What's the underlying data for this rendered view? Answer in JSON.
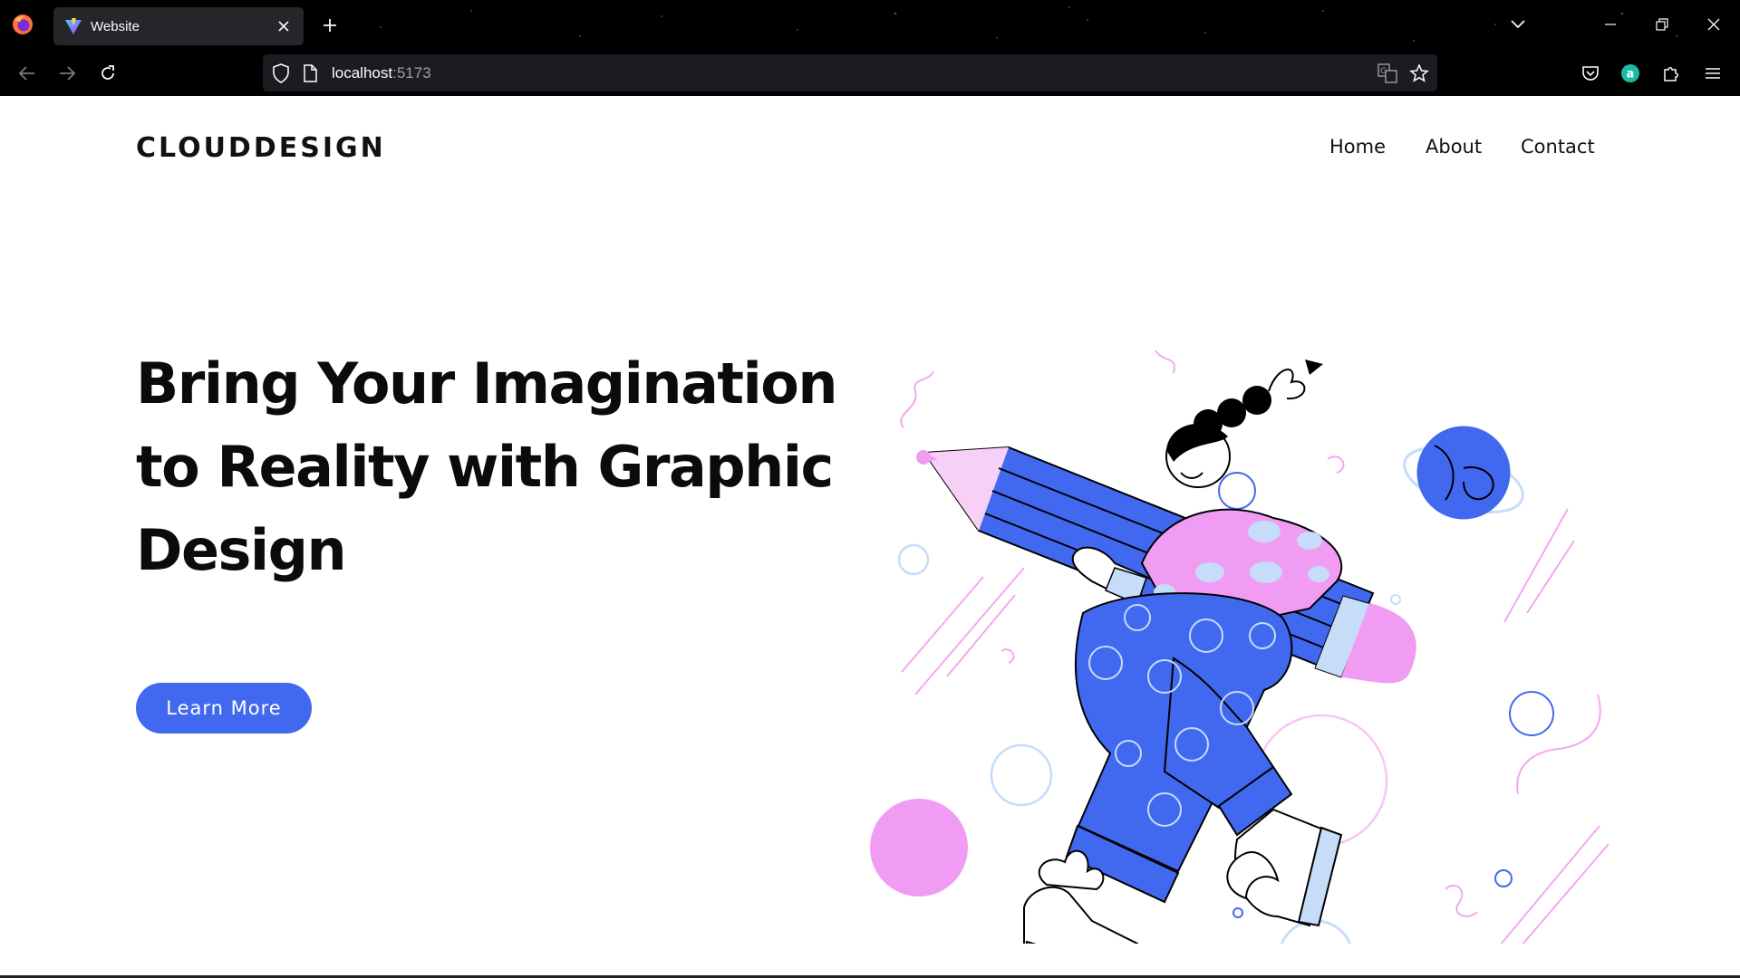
{
  "browser": {
    "tab_title": "Website",
    "url_host": "localhost",
    "url_port": ":5173",
    "icons": {
      "browser_logo": "firefox-icon",
      "tab_favicon": "vite-icon",
      "tab_close": "close-icon",
      "new_tab": "plus-icon",
      "tab_list": "chevron-down-icon",
      "minimize": "minimize-icon",
      "restore": "restore-icon",
      "close_window": "close-icon",
      "back": "back-arrow-icon",
      "forward": "forward-arrow-icon",
      "reload": "reload-icon",
      "shield": "shield-icon",
      "page": "page-icon",
      "translate": "translate-icon",
      "bookmark": "star-icon",
      "pocket": "pocket-icon",
      "account": "account-avatar-icon",
      "extensions": "puzzle-icon",
      "menu": "hamburger-menu-icon"
    },
    "account_letter": "a"
  },
  "site": {
    "brand": "CLOUDDESIGN",
    "nav": [
      "Home",
      "About",
      "Contact"
    ],
    "headline_lines": [
      "Bring Your Imagination",
      "to Reality with Graphic",
      "Design"
    ],
    "cta_label": "Learn More",
    "colors": {
      "accent": "#4169f0",
      "pink": "#f09cf2",
      "light_blue": "#c6dcf8",
      "text": "#0b0b0b"
    }
  }
}
